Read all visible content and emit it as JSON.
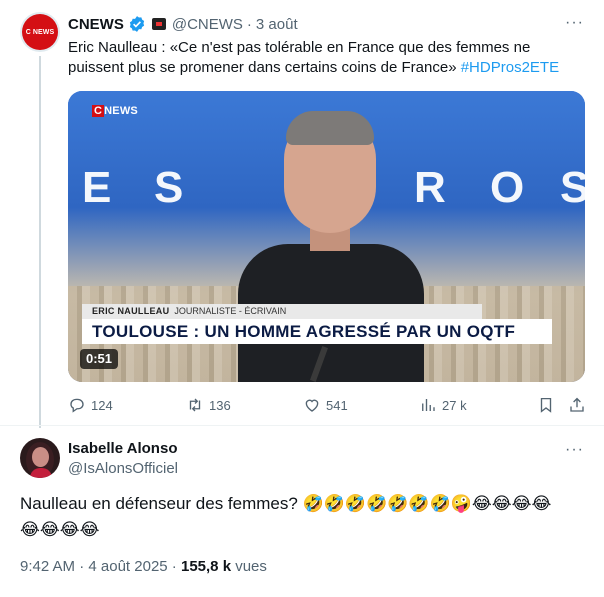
{
  "quoted_tweet": {
    "author_name": "CNEWS",
    "handle": "@CNEWS",
    "separator": "·",
    "time": "3 août",
    "avatar_text": "C NEWS",
    "text": "Eric Naulleau : «Ce n'est pas tolérable en France que des femmes ne puissent plus se promener dans certains coins de France» ",
    "hashtag": "#HDPros2ETE",
    "more": "···",
    "video": {
      "logo_prefix": "C",
      "logo_rest": "NEWS",
      "bg_letters": [
        "E",
        "S",
        "R",
        "O",
        "S"
      ],
      "chyron_name": "ERIC NAULLEAU",
      "chyron_role": "JOURNALISTE - ÉCRIVAIN",
      "chyron_headline": "TOULOUSE : UN HOMME AGRESSÉ PAR UN OQTF",
      "duration": "0:51"
    },
    "actions": {
      "replies": "124",
      "reposts": "136",
      "likes": "541",
      "views": "27 k"
    }
  },
  "tweet": {
    "author_name": "Isabelle Alonso",
    "handle": "@IsAlonsOfficiel",
    "more": "···",
    "text": "Naulleau en défenseur des femmes? ",
    "emojis_line1": "🤣🤣🤣🤣🤣🤣🤣🤪😂😂😂😂",
    "emojis_line2": "😂😂😂😂",
    "time": "9:42 AM",
    "date_sep": " · ",
    "date": "4 août 2025",
    "views_sep": " · ",
    "views_count": "155,8 k",
    "views_label": " vues"
  },
  "colors": {
    "accent": "#1d9bf0",
    "muted": "#536471",
    "brand_red": "#d40f14"
  }
}
